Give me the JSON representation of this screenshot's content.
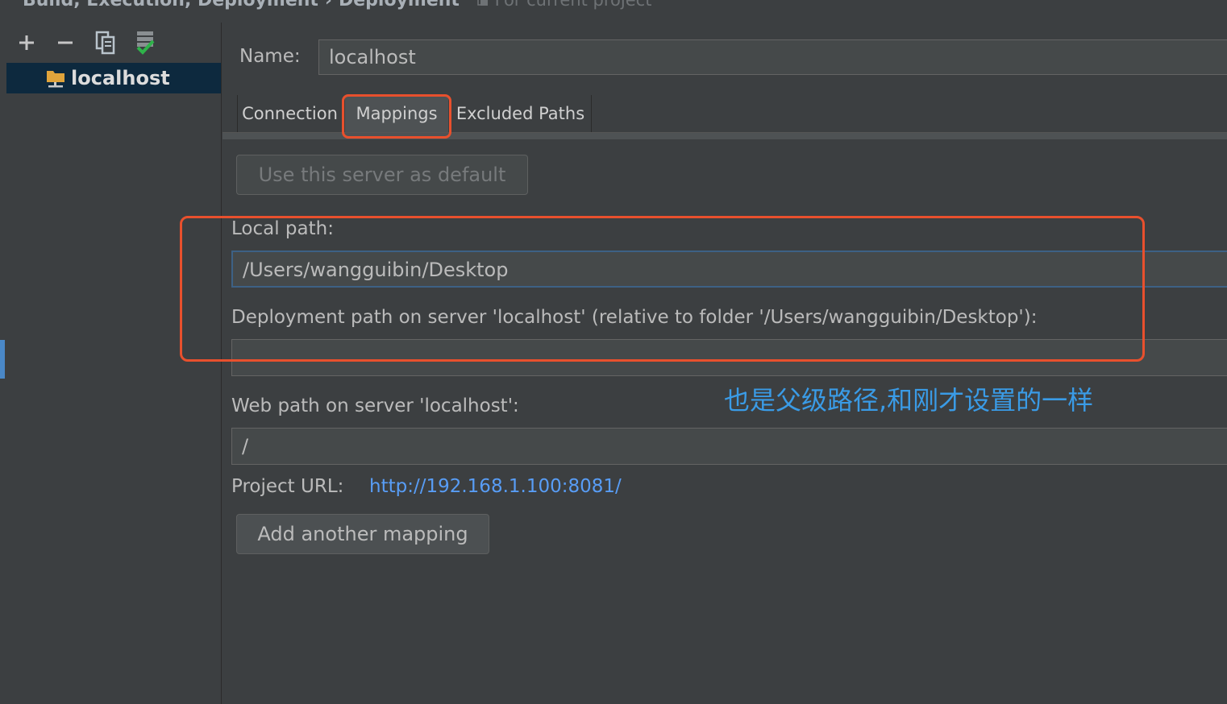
{
  "breadcrumb": {
    "parent": "Build, Execution, Deployment",
    "separator": "›",
    "current": "Deployment",
    "scope_label": "For current project"
  },
  "toolbar": {
    "add_icon": "plus-icon",
    "remove_icon": "minus-icon",
    "copy_icon": "copy-icon",
    "default_icon": "server-default-icon"
  },
  "tree": {
    "items": [
      {
        "label": "localhost",
        "icon": "server-folder-icon",
        "selected": true
      }
    ]
  },
  "form": {
    "name_label": "Name:",
    "name_value": "localhost"
  },
  "tabs": [
    {
      "label": "Connection",
      "active": false
    },
    {
      "label": "Mappings",
      "active": true
    },
    {
      "label": "Excluded Paths",
      "active": false
    }
  ],
  "mappings": {
    "default_button": "Use this server as default",
    "local_path_label": "Local path:",
    "local_path_value": "/Users/wangguibin/Desktop",
    "deployment_path_label": "Deployment path on server 'localhost' (relative to folder '/Users/wangguibin/Desktop'):",
    "deployment_path_value": "",
    "web_path_label": "Web path on server 'localhost':",
    "web_path_value": "/",
    "project_url_label": "Project URL:",
    "project_url_value": "http://192.168.1.100:8081/",
    "add_mapping_button": "Add another mapping"
  },
  "annotation": {
    "text": "也是父级路径,和刚才设置的一样",
    "color": "#3a9be6",
    "highlight_color": "#e8502d"
  }
}
